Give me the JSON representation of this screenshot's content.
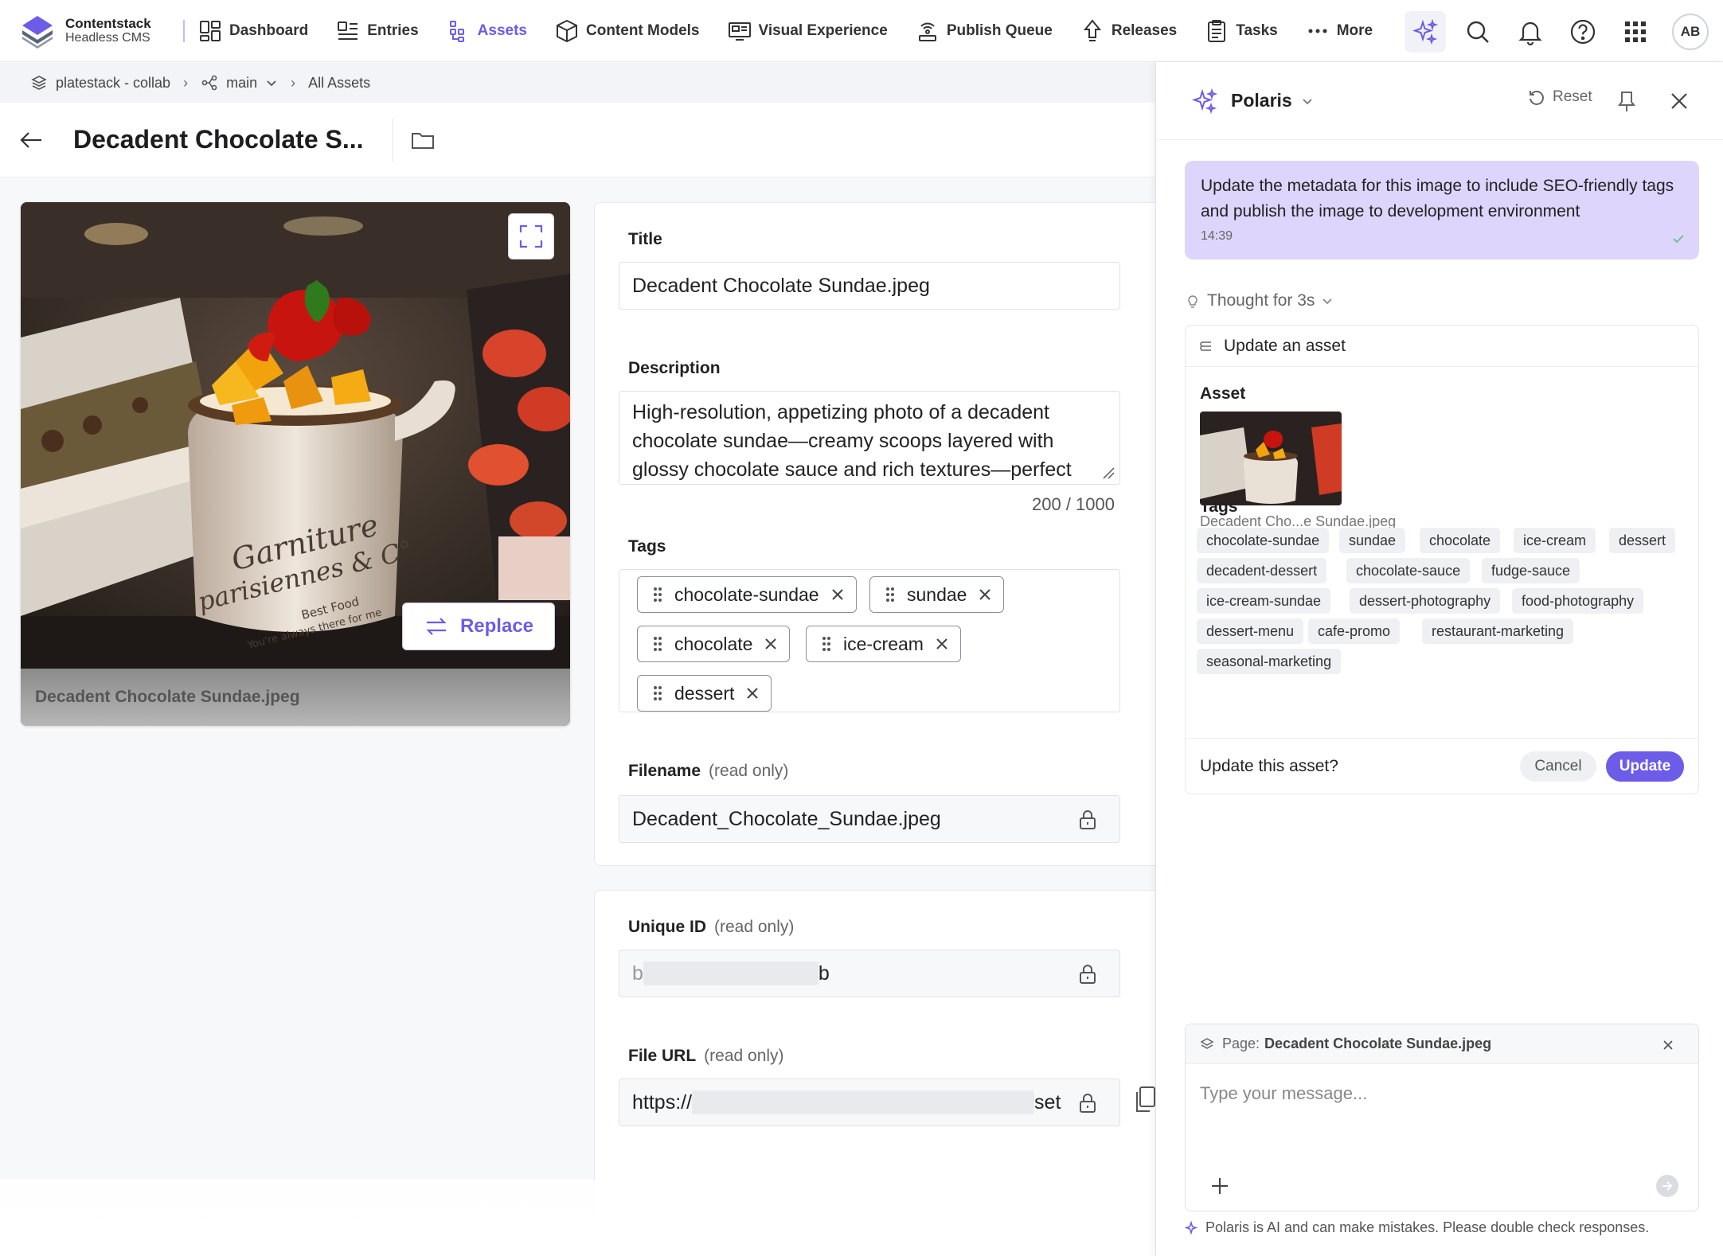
{
  "app": {
    "brand": "Contentstack",
    "sub": "Headless CMS"
  },
  "nav": {
    "items": [
      {
        "label": "Dashboard",
        "icon": "dashboard-icon"
      },
      {
        "label": "Entries",
        "icon": "entries-icon"
      },
      {
        "label": "Assets",
        "icon": "assets-icon"
      },
      {
        "label": "Content Models",
        "icon": "content-models-icon"
      },
      {
        "label": "Visual Experience",
        "icon": "visual-experience-icon"
      },
      {
        "label": "Publish Queue",
        "icon": "publish-queue-icon"
      },
      {
        "label": "Releases",
        "icon": "releases-icon"
      },
      {
        "label": "Tasks",
        "icon": "tasks-icon"
      },
      {
        "label": "More",
        "icon": "more-icon"
      }
    ],
    "active": "Assets",
    "avatar": "AB"
  },
  "breadcrumb": {
    "stack": "platestack - collab",
    "branch": "main",
    "section": "All Assets"
  },
  "page": {
    "title": "Decadent Chocolate S..."
  },
  "image": {
    "caption": "Decadent Chocolate Sundae.jpeg",
    "replace_label": "Replace"
  },
  "form": {
    "title_label": "Title",
    "title_value": "Decadent Chocolate Sundae.jpeg",
    "description_label": "Description",
    "description_value": "High-resolution, appetizing photo of a decadent chocolate sundae—creamy scoops layered with glossy chocolate sauce and rich textures—perfect",
    "description_counter": "200 / 1000",
    "tags_label": "Tags",
    "tags": [
      "chocolate-sundae",
      "sundae",
      "chocolate",
      "ice-cream",
      "dessert"
    ],
    "filename_label": "Filename",
    "read_only": "(read only)",
    "filename_value": "Decadent_Chocolate_Sundae.jpeg",
    "uid_label": "Unique ID",
    "uid_start": "b",
    "uid_end": "b",
    "url_label": "File URL",
    "url_start": "https://",
    "url_end": "set"
  },
  "polaris": {
    "name": "Polaris",
    "reset": "Reset",
    "user_message": "Update the metadata for this image to include SEO-friendly tags and publish the image to development environment",
    "user_time": "14:39",
    "thought": "Thought for 3s",
    "tool_title": "Update an asset",
    "asset_label": "Asset",
    "asset_name": "Decadent Cho...e Sundae.jpeg",
    "tags_label": "Tags",
    "tags": [
      [
        "chocolate-sundae",
        "sundae",
        "chocolate",
        "ice-cream",
        "dessert"
      ],
      [
        "decadent-dessert",
        "chocolate-sauce",
        "fudge-sauce"
      ],
      [
        "ice-cream-sundae",
        "dessert-photography",
        "food-photography"
      ],
      [
        "dessert-menu",
        "cafe-promo",
        "restaurant-marketing"
      ],
      [
        "seasonal-marketing"
      ]
    ],
    "confirm_question": "Update this asset?",
    "cancel": "Cancel",
    "update": "Update",
    "context_prefix": "Page:",
    "context_page": "Decadent Chocolate Sundae.jpeg",
    "input_placeholder": "Type your message...",
    "disclaimer": "Polaris is AI and can make mistakes. Please double check responses."
  },
  "colors": {
    "accent": "#6c5ce7",
    "user_bubble": "#ddd5fb"
  }
}
